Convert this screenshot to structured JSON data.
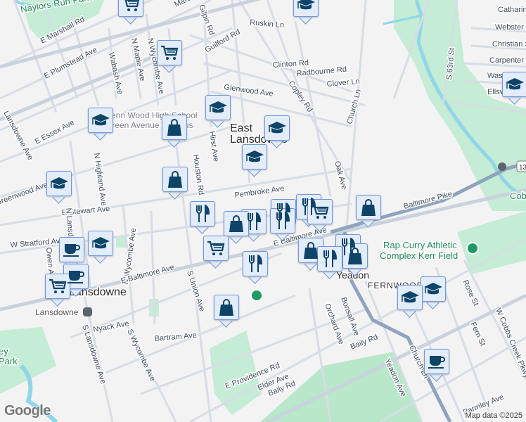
{
  "labels": {
    "marshall_top": "Marsh",
    "e_marshall": "E Marshall Rd",
    "e_plumstead": "E Plumstead Ave",
    "wabash": "Wabash Ave",
    "n_maple": "N Maple Ave",
    "n_wycombe_n": "N Wycombe Ave",
    "gilpin": "Gilpin Rd",
    "guilford": "Guilford Rd",
    "ruskin": "Ruskin Ln",
    "clinton": "Clinton Rd",
    "radbourne": "Radbourne Rd",
    "clover": "Clover Ln",
    "glenwood": "Glenwood Ave",
    "copley": "Copley Rd",
    "church_n": "Church Ln",
    "s63rd": "S 63rd St",
    "catharine": "Catharine St",
    "webster": "Webster St",
    "christian": "Christian St",
    "carpenter": "Carpenter St",
    "washington": "Washington Ave",
    "ellsworth": "Ellsworth St",
    "school_1": "Penn Wood High School",
    "school_2": "Green Avenue Campus",
    "east_lansdowne_1": "East",
    "east_lansdowne_2": "Lansdowne",
    "oak": "Oak Ave",
    "essex": "E Essex Ave",
    "n_highland": "N Highland Ave",
    "hirst": "Hirst Ave",
    "houston": "Houston Rd",
    "pembroke": "Pembroke Ave",
    "stewart": "E Stewart Ave",
    "greenwood": "Greenwood Ave",
    "lansdowne_ave_w": "Lansdowne Ave",
    "n_lansdowne": "N Lansdowne Ave",
    "w_stratford": "W Stratford Ave",
    "owen": "Owen Ave",
    "n_wycombe_s": "N Wycombe Ave",
    "e_baltimore_w": "E Baltimore Ave",
    "s_union": "S Union Ave",
    "lansdowne_town": "Lansdowne",
    "lansdowne_station": "Lansdowne",
    "nyack": "Nyack Ave",
    "s_wycombe": "S Wycombe Ave",
    "bartram": "Bartram Ave",
    "s_lansdowne": "S Lansdowne Ave",
    "e_providence": "E Providence Rd",
    "elder": "Elder Ave",
    "baily_1": "Baily Rd",
    "baily_2": "Baily Rd",
    "baltimore_pike": "Baltimore Pike",
    "e_baltimore_e": "E Baltimore Ave",
    "rap_curry_1": "Rap Curry Athletic",
    "rap_curry_2": "Complex Kerr Field",
    "yeadon": "Yeadon",
    "fernwood": "FERNWOOD",
    "orchard": "Orchard Ave",
    "bonsall": "Bonsall Ave",
    "yeadon_ave": "Yeadon Ave",
    "church_s": "Church Ln",
    "rose": "Rose St",
    "fern": "Fern St",
    "cobbs_pkwy": "W Cobbs Creek Pkwy",
    "parmley": "Parmley Ave",
    "naylors": "Naylors Run Park",
    "cobbs": "Cobbs Creek",
    "ridley_1": "ey",
    "ridley_2": "Park",
    "route": "13"
  },
  "footer": {
    "map_data": "Map data ©2025",
    "google": "Google"
  },
  "colors": {
    "background": "#f4f3f4",
    "road": "#d6dde6",
    "major_road": "#8ea3bd",
    "park": "#c5ecd4",
    "water": "#8fd6ea",
    "marker_fill": "#e3ecfb",
    "marker_border": "#6f97da",
    "marker_icon": "#0d4468"
  }
}
